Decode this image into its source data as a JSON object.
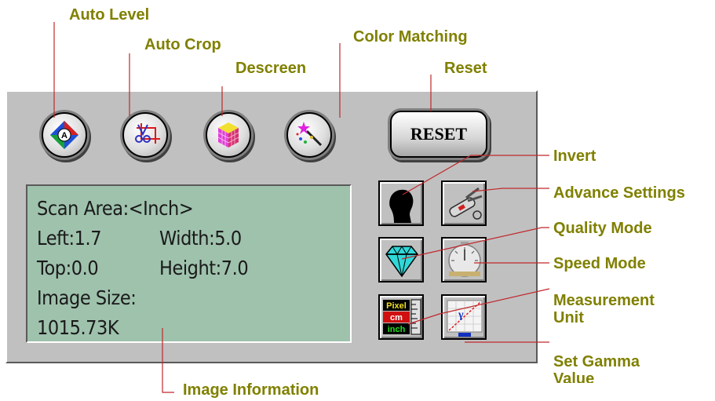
{
  "callouts": {
    "auto_level": "Auto Level",
    "auto_crop": "Auto Crop",
    "descreen": "Descreen",
    "color_matching": "Color Matching",
    "reset": "Reset",
    "invert": "Invert",
    "advance_settings": "Advance Settings",
    "quality_mode": "Quality Mode",
    "speed_mode": "Speed Mode",
    "measurement_unit_line1": "Measurement",
    "measurement_unit_line2": "Unit",
    "set_gamma_line1": "Set Gamma",
    "set_gamma_line2": "Value",
    "image_information": "Image Information"
  },
  "panel": {
    "reset_button": "RESET",
    "info": {
      "scan_area": "Scan Area:<Inch>",
      "left": "Left:1.7",
      "width": "Width:5.0",
      "top": "Top:0.0",
      "height": "Height:7.0",
      "image_size_label": "Image Size:",
      "image_size_value": "1015.73K"
    },
    "unit_icon": {
      "pixel": "Pixel",
      "cm": "cm",
      "inch": "inch"
    },
    "gamma_icon_glyph": "γ"
  },
  "colors": {
    "callout_text": "#808000",
    "leader_line": "#c0282c",
    "panel": "#c0c0c0",
    "lcd": "#9fc2ad"
  },
  "icons": [
    "auto-level-icon",
    "auto-crop-icon",
    "descreen-icon",
    "color-matching-icon",
    "invert-icon",
    "advance-settings-icon",
    "quality-mode-icon",
    "speed-mode-icon",
    "measurement-unit-icon",
    "gamma-icon"
  ]
}
